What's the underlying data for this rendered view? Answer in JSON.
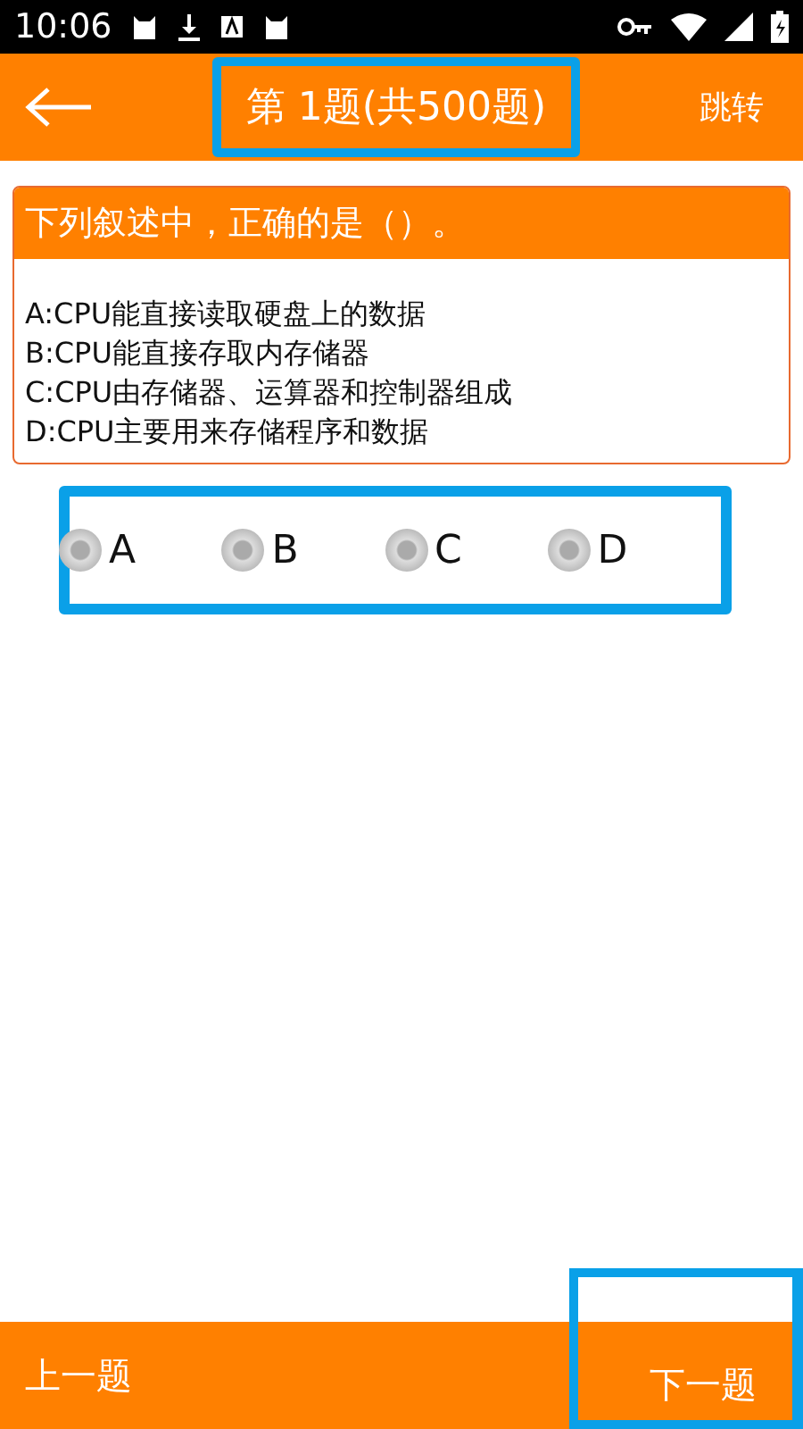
{
  "status_bar": {
    "time": "10:06"
  },
  "toolbar": {
    "title": "第 1题(共500题)",
    "jump": "跳转"
  },
  "question": {
    "stem": "下列叙述中，正确的是（）。",
    "options": [
      "A:CPU能直接读取硬盘上的数据",
      "B:CPU能直接存取内存储器",
      "C:CPU由存储器、运算器和控制器组成",
      "D:CPU主要用来存储程序和数据"
    ]
  },
  "answers": [
    {
      "label": "A",
      "selected": false
    },
    {
      "label": "B",
      "selected": false
    },
    {
      "label": "C",
      "selected": false
    },
    {
      "label": "D",
      "selected": false
    }
  ],
  "bottom_bar": {
    "prev": "上一题",
    "next": "下一题"
  }
}
